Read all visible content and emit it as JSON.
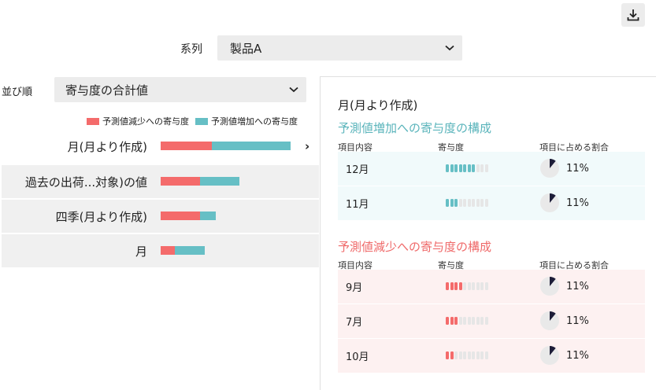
{
  "toolbar": {
    "download_icon": "download-icon"
  },
  "series": {
    "label": "系列",
    "value": "製品A"
  },
  "sort": {
    "label": "並び順",
    "value": "寄与度の合計値"
  },
  "legend": {
    "decrease_label": "予測値減少への寄与度",
    "increase_label": "予測値増加への寄与度",
    "decrease_color": "#f46b6b",
    "increase_color": "#66bfc5"
  },
  "categories": [
    {
      "label": "月(月より作成)",
      "decrease": 0.26,
      "increase": 0.4,
      "selected": true
    },
    {
      "label": "過去の出荷...対象)の値",
      "decrease": 0.2,
      "increase": 0.2
    },
    {
      "label": "四季(月より作成)",
      "decrease": 0.2,
      "increase": 0.08
    },
    {
      "label": "月",
      "decrease": 0.07,
      "increase": 0.15
    }
  ],
  "detail": {
    "title": "月(月より作成)",
    "increase_section": {
      "title": "予測値増加への寄与度の構成",
      "col_item": "項目内容",
      "col_contrib": "寄与度",
      "col_share": "項目に占める割合",
      "rows": [
        {
          "name": "12月",
          "level": 7,
          "share": "11%"
        },
        {
          "name": "11月",
          "level": 3,
          "share": "11%"
        }
      ]
    },
    "decrease_section": {
      "title": "予測値減少への寄与度の構成",
      "col_item": "項目内容",
      "col_contrib": "寄与度",
      "col_share": "項目に占める割合",
      "rows": [
        {
          "name": "9月",
          "level": 4,
          "share": "11%"
        },
        {
          "name": "7月",
          "level": 3,
          "share": "11%"
        },
        {
          "name": "10月",
          "level": 2,
          "share": "11%"
        }
      ]
    }
  }
}
